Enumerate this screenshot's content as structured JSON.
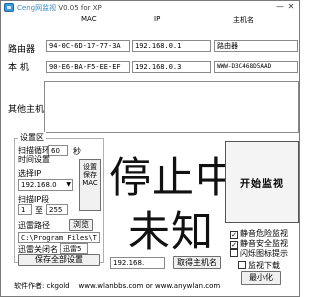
{
  "window": {
    "title_app": "Ceng网监视",
    "title_version": "V0.05 for XP",
    "minimize": "—",
    "close": "✕"
  },
  "columns": {
    "mac": "MAC",
    "ip": "IP",
    "host": "主机名"
  },
  "router": {
    "label": "路由器",
    "mac": "94-0C-6D-17-77-3A",
    "ip": "192.168.0.1",
    "host": "路由器"
  },
  "local": {
    "label": "本  机",
    "mac": "90-E6-BA-F5-EE-EF",
    "ip": "192.168.0.3",
    "host": "WWW-D3C468D5AAD"
  },
  "other_hosts": {
    "label": "其他主机"
  },
  "settings": {
    "group_title": "设置区",
    "scan_interval_label": "扫描循环",
    "scan_interval_value": "60",
    "scan_interval_unit": "秒",
    "interval_setting_label": "时间设置",
    "select_ip_label": "选择IP",
    "select_ip_value": "192.168.0",
    "scan_range_label": "扫描IP段",
    "range_start": "1",
    "range_to": "至",
    "range_end": "255",
    "save_button_text": "设置保存MAC",
    "thunder_path_label": "迅雷路径",
    "browse_button": "浏览",
    "thunder_path_value": "C:\\Program Files\\T",
    "thunder_close_label": "迅雷关闭名",
    "thunder_close_value": "迅雷5",
    "save_all_button": "保存全部设置"
  },
  "status": {
    "line1": "停止中",
    "line2": "未知"
  },
  "ip_input": {
    "value": "192.168."
  },
  "get_host_button": "取得主机名",
  "start_button": "开始监视",
  "options": [
    {
      "label": "静音危险监视",
      "checked": true
    },
    {
      "label": "静音安全监视",
      "checked": true
    },
    {
      "label": "闪烁图标提示",
      "checked": false
    },
    {
      "label": "监视下载",
      "checked": false
    }
  ],
  "minimize_button": "最小化",
  "footer": {
    "author_label": "软件作者:",
    "author": "ckgold",
    "site1": "www.wlanbbs.com",
    "or": "or",
    "site2": "www.anywlan.com"
  }
}
